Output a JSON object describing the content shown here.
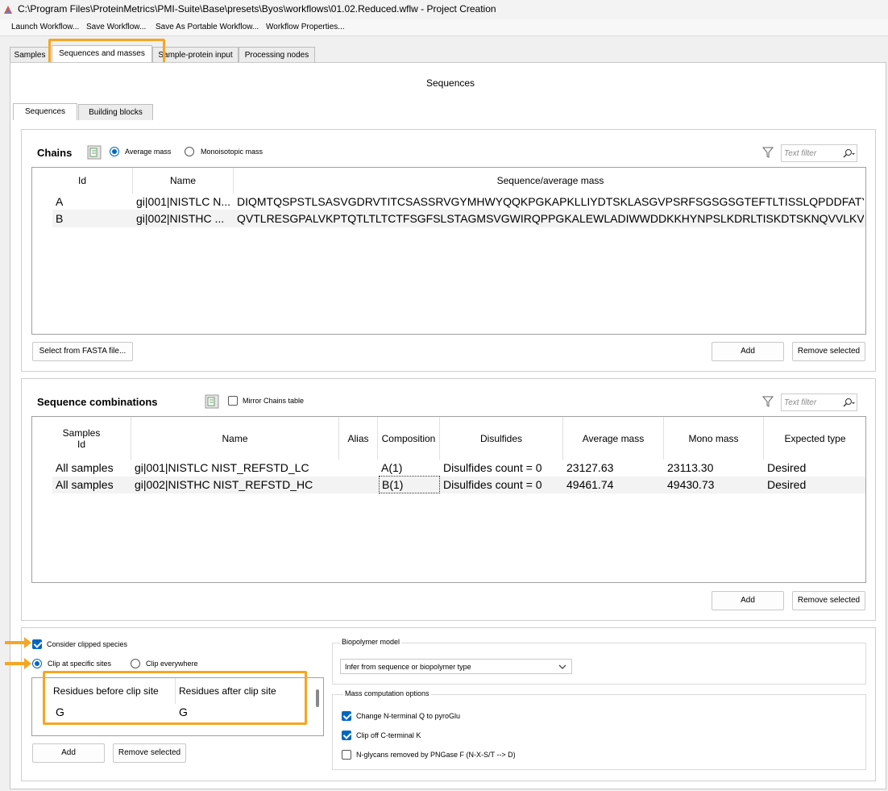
{
  "window": {
    "title": "C:\\Program Files\\ProteinMetrics\\PMI-Suite\\Base\\presets\\Byos\\workflows\\01.02.Reduced.wflw - Project Creation"
  },
  "toolbar": {
    "launch": "Launch Workflow...",
    "save": "Save Workflow...",
    "save_portable": "Save As Portable Workflow...",
    "properties": "Workflow Properties..."
  },
  "top_tabs": [
    "Samples",
    "Sequences and masses",
    "Sample-protein input",
    "Processing nodes"
  ],
  "section_title": "Sequences",
  "sub_tabs": [
    "Sequences",
    "Building blocks"
  ],
  "chains": {
    "title": "Chains",
    "average_mass": "Average mass",
    "monoisotopic_mass": "Monoisotopic mass",
    "filter_placeholder": "Text filter",
    "columns": [
      "Id",
      "Name",
      "Sequence/average mass"
    ],
    "rows": [
      {
        "id": "A",
        "name": "gi|001|NISTLC N...",
        "sequence": "DIQMTQSPSTLSASVGDRVTITCSASSRVGYMHWYQQKPGKAPKLLIYDTSKLASGVPSRFSGSGSGTEFTLTISSLQPDDFATYYCF..."
      },
      {
        "id": "B",
        "name": "gi|002|NISTHC ...",
        "sequence": "QVTLRESGPALVKPTQTLTLTCTFSGFSLSTAGMSVGWIRQPPGKALEWLADIWWDDKKHYNPSLKDRLTISKDTSKNQVVLKVTN..."
      }
    ],
    "select_fasta": "Select from FASTA file...",
    "add": "Add",
    "remove": "Remove selected"
  },
  "combos": {
    "title": "Sequence combinations",
    "mirror": "Mirror Chains table",
    "filter_placeholder": "Text filter",
    "columns": [
      "Samples\nId",
      "Name",
      "Alias",
      "Composition",
      "Disulfides",
      "Average mass",
      "Mono mass",
      "Expected type"
    ],
    "rows": [
      {
        "samples": "All samples",
        "name": "gi|001|NISTLC NIST_REFSTD_LC",
        "alias": "",
        "composition": "A(1)",
        "disulfides": "Disulfides count = 0",
        "avg": "23127.63",
        "mono": "23113.30",
        "type": "Desired"
      },
      {
        "samples": "All samples",
        "name": "gi|002|NISTHC NIST_REFSTD_HC",
        "alias": "",
        "composition": "B(1)",
        "disulfides": "Disulfides count = 0",
        "avg": "49461.74",
        "mono": "49430.73",
        "type": "Desired"
      }
    ],
    "add": "Add",
    "remove": "Remove selected"
  },
  "clipping": {
    "consider": "Consider clipped species",
    "clip_specific": "Clip at specific sites",
    "clip_everywhere": "Clip everywhere",
    "col_before": "Residues before clip site",
    "col_after": "Residues after clip site",
    "before": "G",
    "after": "G",
    "add": "Add",
    "remove": "Remove selected"
  },
  "biopolymer": {
    "title": "Biopolymer model",
    "value": "Infer from sequence or biopolymer type"
  },
  "mass_options": {
    "title": "Mass computation options",
    "opt1": "Change N-terminal Q to pyroGlu",
    "opt2": "Clip off C-terminal K",
    "opt3": "N-glycans removed by PNGase F (N-X-S/T --> D)"
  },
  "colors": {
    "accent": "#0067c0",
    "highlight": "#f5a623"
  }
}
